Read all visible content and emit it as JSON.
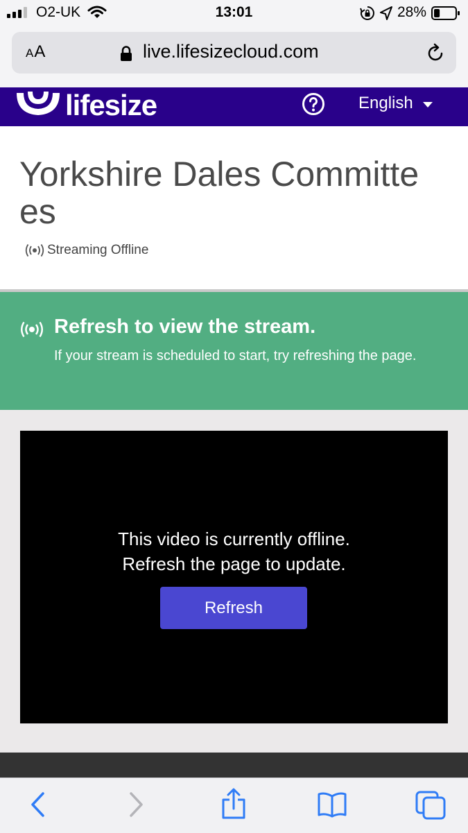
{
  "status_bar": {
    "carrier": "O2-UK",
    "time": "13:01",
    "battery_percent": "28%",
    "battery_level": 0.28,
    "icons": [
      "signal-icon",
      "wifi-icon",
      "rotation-lock-icon",
      "location-icon",
      "battery-icon"
    ]
  },
  "browser": {
    "text_size_label": "AA",
    "url": "live.lifesizecloud.com",
    "icons": [
      "padlock-icon",
      "reload-icon"
    ]
  },
  "site_header": {
    "logo_text": "lifesize",
    "language": "English",
    "icons": [
      "lifesize-logo-icon",
      "help-icon",
      "caret-down-icon"
    ]
  },
  "event": {
    "title": "Yorkshire Dales Committees",
    "stream_status": "Streaming Offline"
  },
  "banner": {
    "heading": "Refresh to view the stream.",
    "message": "If your stream is scheduled to start, try refreshing the page."
  },
  "player": {
    "offline_line1": "This video is currently offline.",
    "offline_line2": "Refresh the page to update.",
    "refresh_label": "Refresh"
  },
  "toolbar": {
    "icons": [
      "back-icon",
      "forward-icon",
      "share-icon",
      "bookmarks-icon",
      "tabs-icon"
    ]
  },
  "colors": {
    "header_bg": "#29018a",
    "banner_bg": "#52ae82",
    "button_bg": "#4a47d1",
    "ios_blue": "#2f7cf6"
  }
}
